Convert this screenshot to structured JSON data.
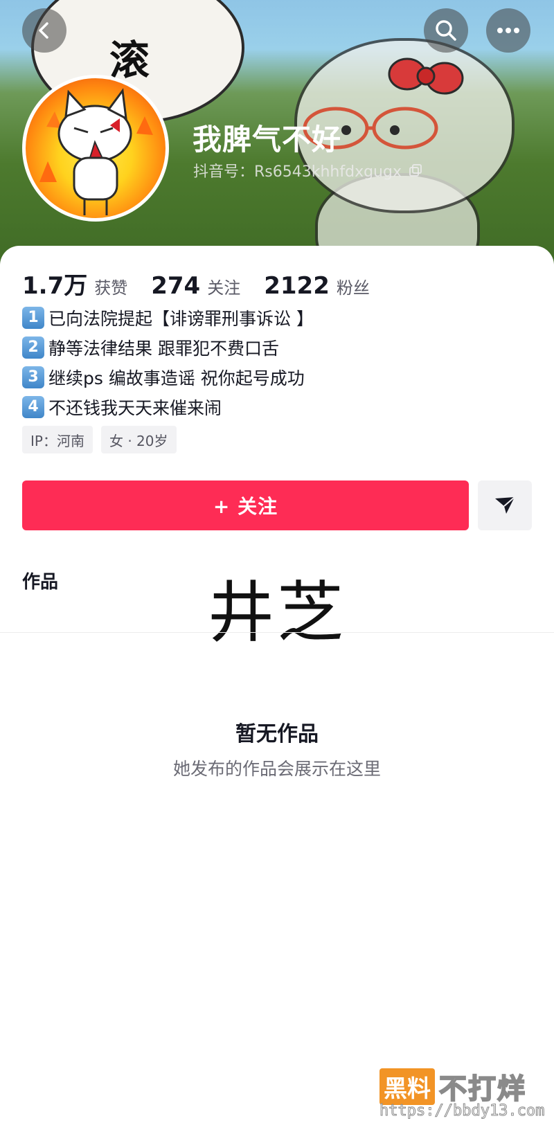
{
  "header": {
    "banner_text": "滚",
    "nickname": "我脾气不好",
    "douyin_id": "抖音号：Rs6543khhfdxgugx"
  },
  "stats": [
    {
      "value": "1.7万",
      "label": "获赞"
    },
    {
      "value": "274",
      "label": "关注"
    },
    {
      "value": "2122",
      "label": "粉丝"
    }
  ],
  "bio": [
    {
      "num": "1",
      "text": "已向法院提起【诽谤罪刑事诉讼 】"
    },
    {
      "num": "2",
      "text": "静等法律结果 跟罪犯不费口舌"
    },
    {
      "num": "3",
      "text": "继续ps 编故事造谣 祝你起号成功"
    },
    {
      "num": "4",
      "text": "不还钱我天天来催来闹"
    }
  ],
  "tags": [
    "IP：河南",
    "女 · 20岁"
  ],
  "actions": {
    "follow_label": "+ 关注"
  },
  "tabs": {
    "works_label": "作品"
  },
  "overlay_text": "井芝",
  "empty": {
    "title": "暂无作品",
    "subtitle": "她发布的作品会展示在这里"
  },
  "watermark": {
    "box": "黑料",
    "text": "不打烊",
    "url": "https://bbdy13.com"
  },
  "colors": {
    "accent": "#fe2c55",
    "watermark": "#f29426"
  },
  "icons": [
    "back-icon",
    "search-icon",
    "more-icon",
    "copy-icon",
    "share-icon"
  ]
}
